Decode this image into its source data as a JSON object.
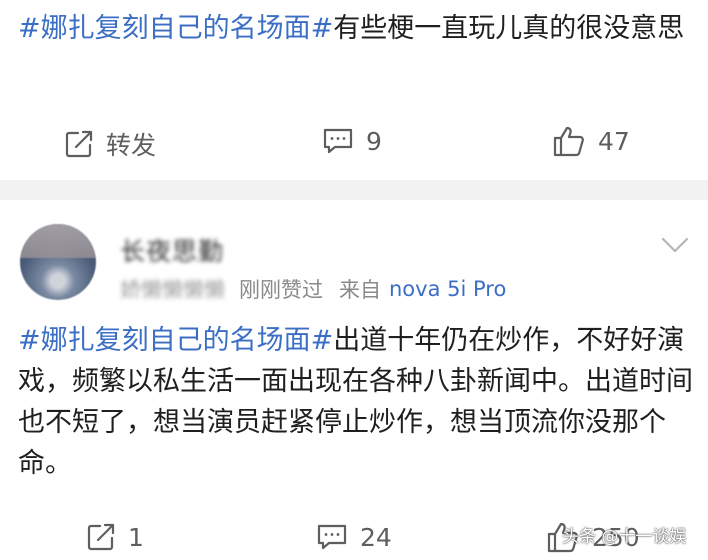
{
  "post1": {
    "hashtag": "#娜扎复刻自己的名场面#",
    "text": "有些梗一直玩儿真的很没意思",
    "actions": {
      "repost_label": "转发",
      "comments": "9",
      "likes": "47"
    }
  },
  "post2": {
    "username": "长夜思勤",
    "meta_blurred": "娇懒懒懒懒",
    "liked_status": "刚刚赞过",
    "source_prefix": "来自",
    "device": "nova 5i Pro",
    "hashtag": "#娜扎复刻自己的名场面#",
    "text": "出道十年仍在炒作，不好好演戏，频繁以私生活一面出现在各种八卦新闻中。出道时间也不短了，想当演员赶紧停止炒作，想当顶流你没那个命。",
    "actions": {
      "reposts": "1",
      "comments": "24",
      "likes": "250"
    }
  },
  "watermark": "头条 @十一谈娱",
  "colors": {
    "link": "#3b6ec5",
    "text": "#1f1f1f",
    "muted": "#8a8a8a",
    "divider": "#f2f2f2"
  }
}
